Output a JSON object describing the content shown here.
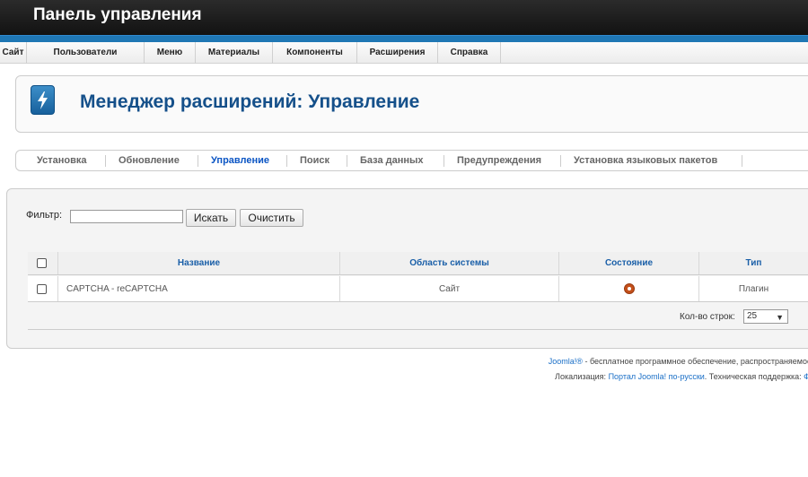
{
  "header": {
    "title": "Панель управления"
  },
  "menu": [
    {
      "label": "Сайт"
    },
    {
      "label": "Пользователи"
    },
    {
      "label": "Меню"
    },
    {
      "label": "Материалы"
    },
    {
      "label": "Компоненты"
    },
    {
      "label": "Расширения"
    },
    {
      "label": "Справка"
    }
  ],
  "page": {
    "title": "Менеджер расширений: Управление"
  },
  "tabs": [
    {
      "label": "Установка"
    },
    {
      "label": "Обновление"
    },
    {
      "label": "Управление"
    },
    {
      "label": "Поиск"
    },
    {
      "label": "База данных"
    },
    {
      "label": "Предупреждения"
    },
    {
      "label": "Установка языковых пакетов"
    }
  ],
  "active_tab": "Управление",
  "filter": {
    "label": "Фильтр:",
    "value": "",
    "search_button": "Искать",
    "clear_button": "Очистить"
  },
  "table": {
    "headers": {
      "name": "Название",
      "area": "Область системы",
      "status": "Состояние",
      "type": "Тип"
    },
    "rows": [
      {
        "name": "CAPTCHA - reCAPTCHA",
        "area": "Сайт",
        "status": "enabled",
        "type": "Плагин"
      }
    ]
  },
  "pagination": {
    "label": "Кол-во строк:",
    "value": "25"
  },
  "footer": {
    "line1_link": "Joomla!®",
    "line1_text": " - бесплатное программное обеспечение, распространяемое",
    "line2_label": "Локализация: ",
    "line2_link": "Портал Joomla! по-русски",
    "line2_text": ". Техническая поддержка: ",
    "line2_link2": "Ф"
  },
  "colors": {
    "accent_blue": "#1f77b4",
    "title_blue": "#15508a",
    "active_tab": "#0b55c4",
    "status_enabled": "#c4501a"
  }
}
